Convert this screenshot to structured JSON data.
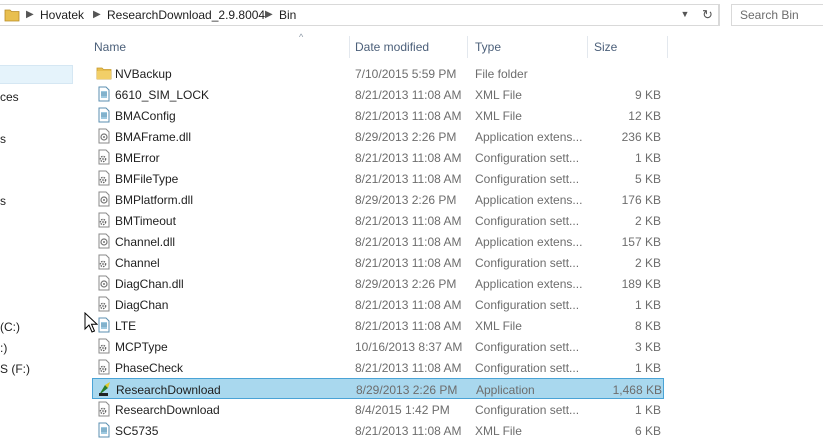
{
  "address": {
    "crumbs": [
      "Hovatek",
      "ResearchDownload_2.9.8004",
      "Bin"
    ],
    "search_placeholder": "Search Bin"
  },
  "nav": {
    "fragments": [
      "ces",
      "s",
      "s",
      "(C:)",
      ":)",
      "S (F:)"
    ]
  },
  "columns": {
    "name": "Name",
    "date": "Date modified",
    "type": "Type",
    "size": "Size"
  },
  "files": [
    {
      "name": "NVBackup",
      "date": "7/10/2015 5:59 PM",
      "type": "File folder",
      "size": "",
      "icon": "folder-icon"
    },
    {
      "name": "6610_SIM_LOCK",
      "date": "8/21/2013 11:08 AM",
      "type": "XML File",
      "size": "9 KB",
      "icon": "xml-file-icon"
    },
    {
      "name": "BMAConfig",
      "date": "8/21/2013 11:08 AM",
      "type": "XML File",
      "size": "12 KB",
      "icon": "xml-file-icon"
    },
    {
      "name": "BMAFrame.dll",
      "date": "8/29/2013 2:26 PM",
      "type": "Application extens...",
      "size": "236 KB",
      "icon": "dll-file-icon"
    },
    {
      "name": "BMError",
      "date": "8/21/2013 11:08 AM",
      "type": "Configuration sett...",
      "size": "1 KB",
      "icon": "config-file-icon"
    },
    {
      "name": "BMFileType",
      "date": "8/21/2013 11:08 AM",
      "type": "Configuration sett...",
      "size": "5 KB",
      "icon": "config-file-icon"
    },
    {
      "name": "BMPlatform.dll",
      "date": "8/29/2013 2:26 PM",
      "type": "Application extens...",
      "size": "176 KB",
      "icon": "dll-file-icon"
    },
    {
      "name": "BMTimeout",
      "date": "8/21/2013 11:08 AM",
      "type": "Configuration sett...",
      "size": "2 KB",
      "icon": "config-file-icon"
    },
    {
      "name": "Channel.dll",
      "date": "8/21/2013 11:08 AM",
      "type": "Application extens...",
      "size": "157 KB",
      "icon": "dll-file-icon"
    },
    {
      "name": "Channel",
      "date": "8/21/2013 11:08 AM",
      "type": "Configuration sett...",
      "size": "2 KB",
      "icon": "config-file-icon"
    },
    {
      "name": "DiagChan.dll",
      "date": "8/29/2013 2:26 PM",
      "type": "Application extens...",
      "size": "189 KB",
      "icon": "dll-file-icon"
    },
    {
      "name": "DiagChan",
      "date": "8/21/2013 11:08 AM",
      "type": "Configuration sett...",
      "size": "1 KB",
      "icon": "config-file-icon"
    },
    {
      "name": "LTE",
      "date": "8/21/2013 11:08 AM",
      "type": "XML File",
      "size": "8 KB",
      "icon": "xml-file-icon"
    },
    {
      "name": "MCPType",
      "date": "10/16/2013 8:37 AM",
      "type": "Configuration sett...",
      "size": "3 KB",
      "icon": "config-file-icon"
    },
    {
      "name": "PhaseCheck",
      "date": "8/21/2013 11:08 AM",
      "type": "Configuration sett...",
      "size": "1 KB",
      "icon": "config-file-icon"
    },
    {
      "name": "ResearchDownload",
      "date": "8/29/2013 2:26 PM",
      "type": "Application",
      "size": "1,468 KB",
      "icon": "application-icon",
      "state": "selected-active"
    },
    {
      "name": "ResearchDownload",
      "date": "8/4/2015 1:42 PM",
      "type": "Configuration sett...",
      "size": "1 KB",
      "icon": "config-file-icon"
    },
    {
      "name": "SC5735",
      "date": "8/21/2013 11:08 AM",
      "type": "XML File",
      "size": "6 KB",
      "icon": "xml-file-icon"
    }
  ],
  "colors": {
    "selected_bg": "#a9d8ee",
    "selected_border": "#4aa3d6",
    "header_text": "#4c607a",
    "folder": "#e8bf4f"
  }
}
